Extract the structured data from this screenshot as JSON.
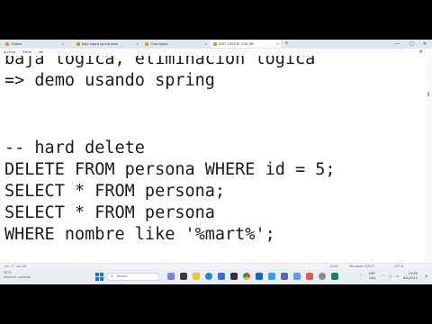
{
  "browser": {
    "tabs": [
      {
        "label": "Ollama",
        "active": false
      },
      {
        "label": "baja logica spring boot",
        "active": false
      },
      {
        "label": "Chat logico",
        "active": false
      },
      {
        "label": "SOFT DELETE CON JPA",
        "active": true
      }
    ],
    "new_tab_symbol": "+",
    "window_controls": {
      "minimize": "—",
      "maximize": "▢",
      "close": "✕"
    }
  },
  "menubar": {
    "items": [
      "Archivo",
      "Editar",
      "Ver"
    ]
  },
  "editor": {
    "lines": [
      "baja lógica, eliminación lógica",
      "=> demo usando spring",
      "",
      "",
      "-- hard delete",
      "DELETE FROM persona WHERE id = 5;",
      "SELECT * FROM persona;",
      "SELECT * FROM persona",
      "WHERE nombre like '%mart%';"
    ]
  },
  "statusbar": {
    "position": "Lín 17, Col 28",
    "zoom": "100%",
    "line_ending": "Windows (CRLF)",
    "encoding": "UTF-8"
  },
  "taskbar": {
    "weather_temp": "22°C",
    "weather_desc": "Mayorm. soleado",
    "search_placeholder": "Buscar",
    "tray_lang": "ESP",
    "tray_layout": "LAA",
    "time": "19:09",
    "date": "8/4/2024"
  }
}
